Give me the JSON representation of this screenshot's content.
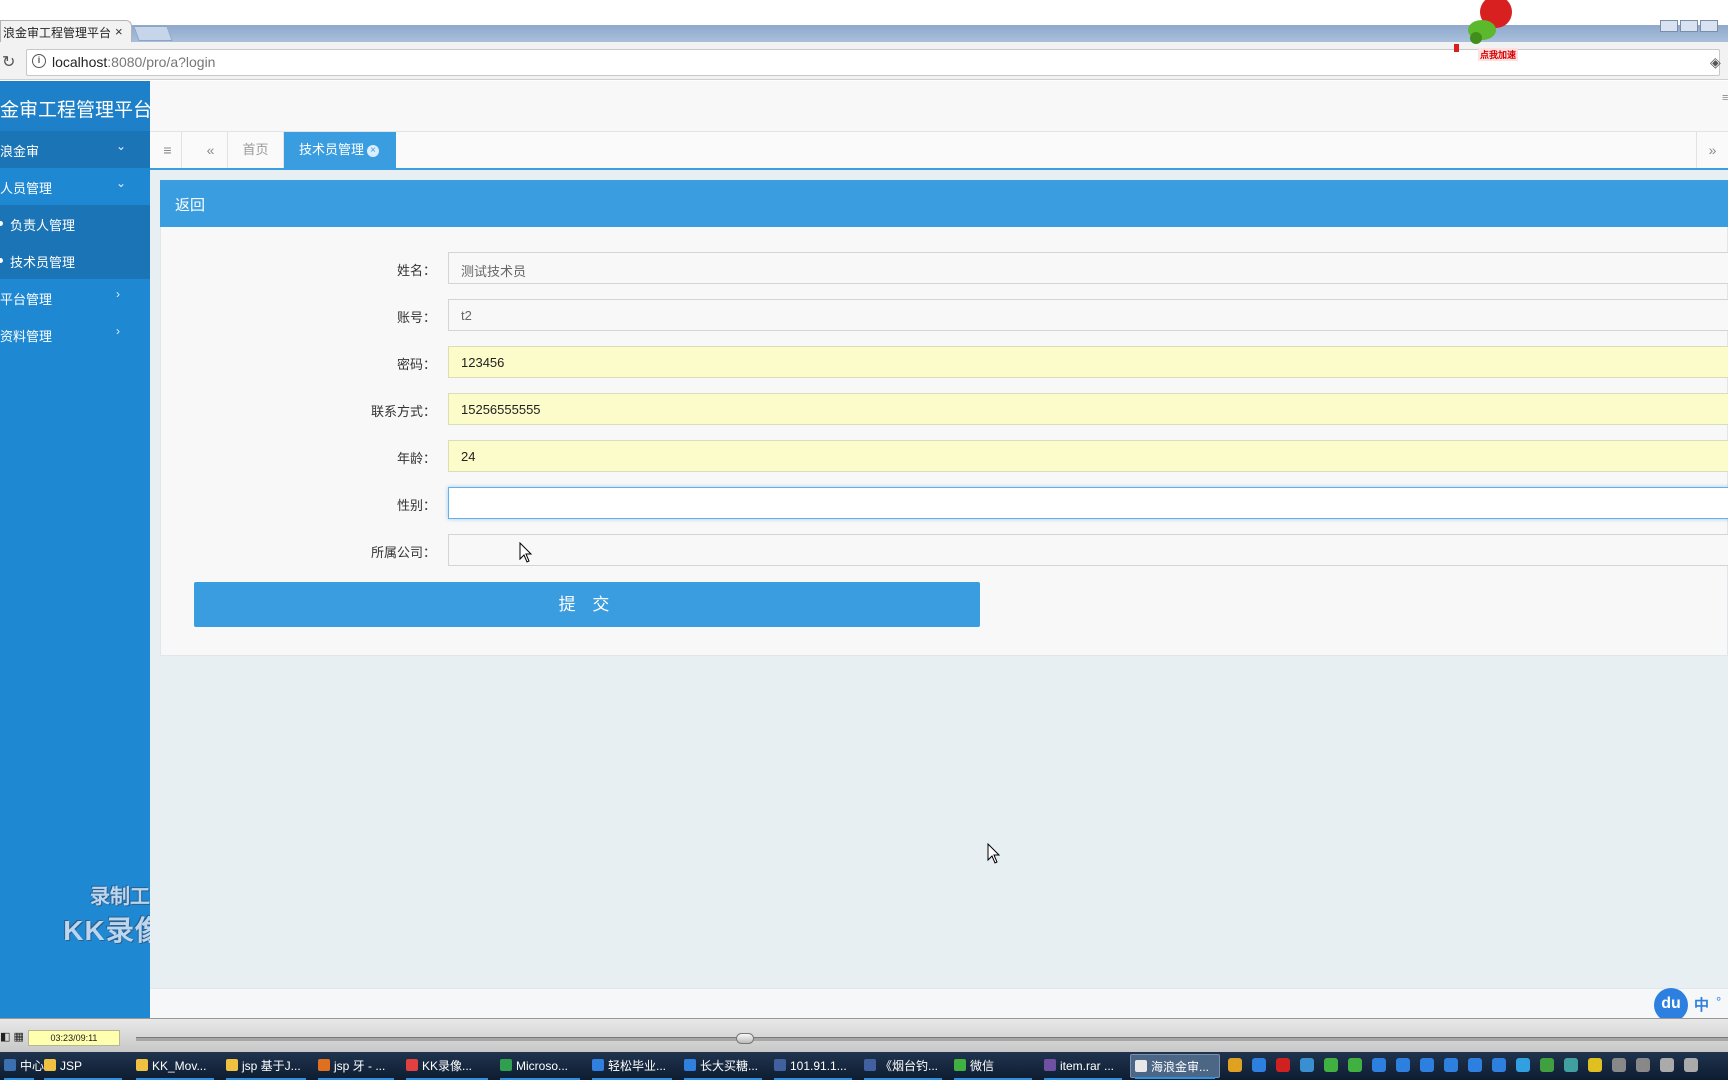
{
  "browser": {
    "tab_title": "浪金审工程管理平台",
    "tab_close": "×",
    "url_host": "localhost",
    "url_rest": ":8080/pro/a?login",
    "extension_label": "点我加速"
  },
  "sidebar": {
    "brand": "金审工程管理平台",
    "items": [
      {
        "label": "浪金审",
        "chevron": "⌄"
      },
      {
        "label": "人员管理",
        "chevron": "⌄"
      },
      {
        "label": "负责人管理"
      },
      {
        "label": "技术员管理"
      },
      {
        "label": "平台管理",
        "chevron": "›"
      },
      {
        "label": "资料管理",
        "chevron": "›"
      }
    ]
  },
  "tabs": {
    "home": "首页",
    "active": "技术员管理",
    "active_close": "×"
  },
  "panel": {
    "back": "返回"
  },
  "form": {
    "name_label": "姓名：",
    "name_value": "测试技术员",
    "account_label": "账号：",
    "account_value": "t2",
    "password_label": "密码：",
    "password_value": "123456",
    "contact_label": "联系方式：",
    "contact_value": "15256555555",
    "age_label": "年龄：",
    "age_value": "24",
    "gender_label": "性别：",
    "gender_value": "",
    "company_label": "所属公司：",
    "company_value": "",
    "submit": "提 交"
  },
  "watermark": {
    "line1": "录制工具",
    "line2": "KK录像机"
  },
  "ime": {
    "baidu": "du",
    "zh": "中",
    "dot": "°"
  },
  "player": {
    "time": "03:23/09:11"
  },
  "taskbar": {
    "items": [
      {
        "label": "中心...",
        "color": "#3a6fb0"
      },
      {
        "label": "JSP",
        "color": "#f0c040"
      },
      {
        "label": "KK_Mov...",
        "color": "#f0c040"
      },
      {
        "label": "jsp 基于J...",
        "color": "#f0c040"
      },
      {
        "label": "jsp 牙 - ...",
        "color": "#e07020"
      },
      {
        "label": "KK录像...",
        "color": "#e04040"
      },
      {
        "label": "Microso...",
        "color": "#30a050"
      },
      {
        "label": "轻松毕业...",
        "color": "#3080e0"
      },
      {
        "label": "长大买糖...",
        "color": "#3080e0"
      },
      {
        "label": "101.91.1...",
        "color": "#4060a0"
      },
      {
        "label": "《烟台钓...",
        "color": "#4060a0"
      },
      {
        "label": "微信",
        "color": "#40b040"
      },
      {
        "label": "item.rar ...",
        "color": "#7050a0"
      },
      {
        "label": "海浪金审...",
        "color": "#e8e8e8"
      }
    ]
  }
}
